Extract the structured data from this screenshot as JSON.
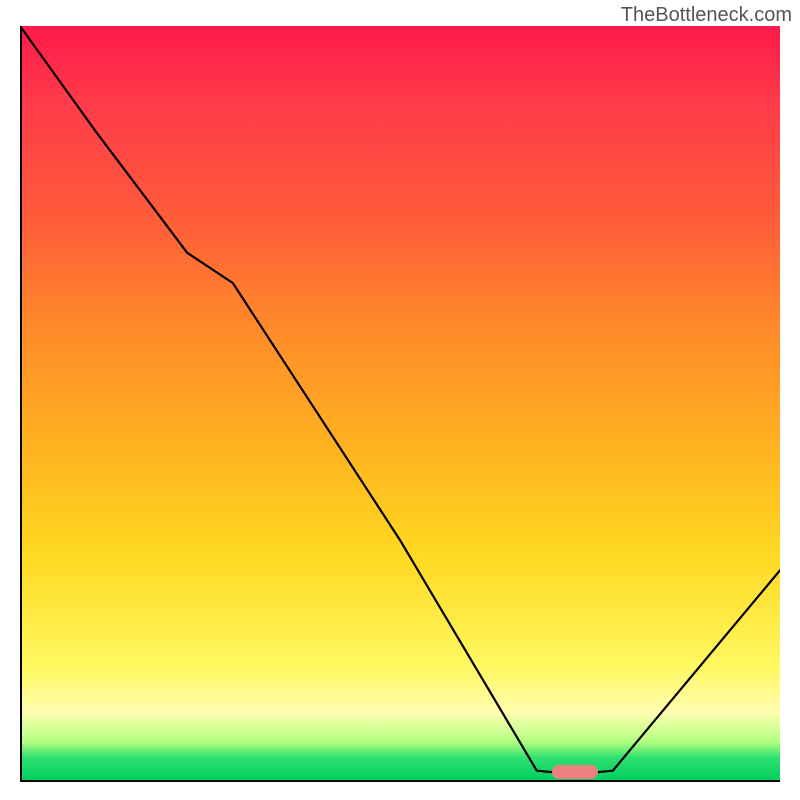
{
  "watermark": "TheBottleneck.com",
  "colors": {
    "gradient_top": "#ff1a4a",
    "gradient_bottom": "#00d060",
    "curve": "#000000",
    "marker": "#f08080",
    "axis": "#000000"
  },
  "chart_data": {
    "type": "line",
    "title": "",
    "xlabel": "",
    "ylabel": "",
    "xlim": [
      0,
      100
    ],
    "ylim": [
      0,
      100
    ],
    "x": [
      0,
      10,
      22,
      28,
      50,
      68,
      73,
      78,
      100
    ],
    "values": [
      100,
      86,
      70,
      66,
      32,
      1.5,
      1,
      1.5,
      28
    ],
    "marker_x": 73,
    "marker_y": 1,
    "annotations": []
  }
}
